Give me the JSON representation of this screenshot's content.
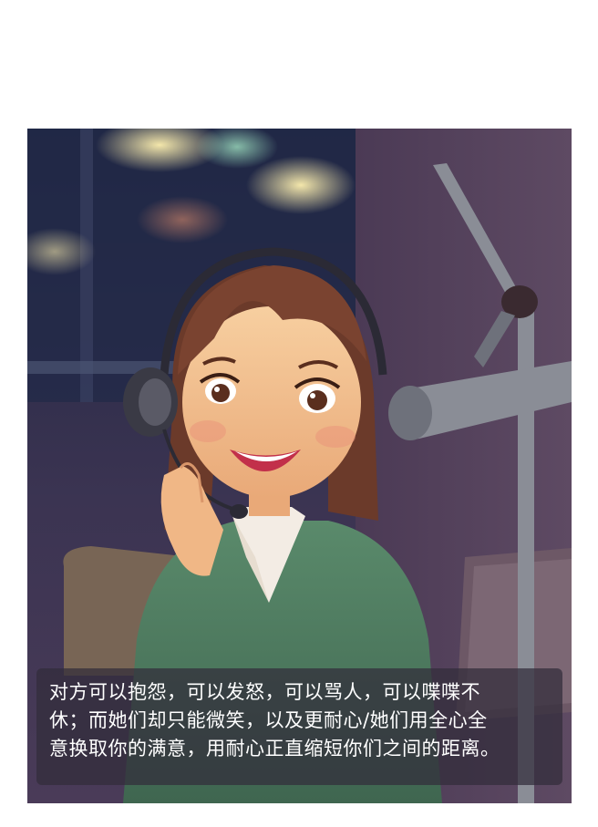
{
  "illustration": {
    "subject": "customer-service-agent-with-headset",
    "colors": {
      "background": "#3a2f4a",
      "sweater": "#4f7a5e",
      "collar": "#f3ece4",
      "hair": "#6b3a2a",
      "skin": "#f2bf8e",
      "mic": "#8a8d96"
    }
  },
  "caption": {
    "lines": [
      "对方可以抱怨，可以发怒，可以骂人，可以喋喋不",
      "休；而她们却只能微笑，以及更耐心/她们用全心全",
      "意换取你的满意，用耐心正直缩短你们之间的距离。"
    ]
  }
}
